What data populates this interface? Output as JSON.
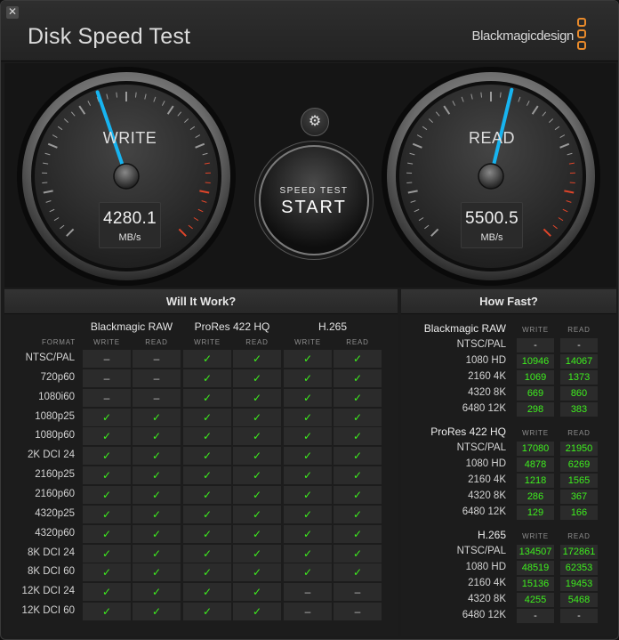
{
  "app": {
    "title": "Disk Speed Test",
    "brand": "Blackmagicdesign",
    "close_glyph": "✕",
    "accent_color": "#e88a2b"
  },
  "gauges": {
    "write": {
      "label": "WRITE",
      "value": "4280.1",
      "unit": "MB/s",
      "fraction": 0.43
    },
    "read": {
      "label": "READ",
      "value": "5500.5",
      "unit": "MB/s",
      "fraction": 0.55
    },
    "needle_color": "#17b4f0",
    "redline_color": "#e0452a"
  },
  "controls": {
    "settings_icon": "gear-icon",
    "settings_glyph": "⚙",
    "start_line1": "SPEED TEST",
    "start_line2": "START"
  },
  "will_it_work": {
    "title": "Will It Work?",
    "format_header": "FORMAT",
    "codecs": [
      "Blackmagic RAW",
      "ProRes 422 HQ",
      "H.265"
    ],
    "col_write": "WRITE",
    "col_read": "READ",
    "ok_glyph": "✓",
    "no_glyph": "–",
    "rows": [
      {
        "format": "NTSC/PAL",
        "cells": [
          0,
          0,
          1,
          1,
          1,
          1
        ]
      },
      {
        "format": "720p60",
        "cells": [
          0,
          0,
          1,
          1,
          1,
          1
        ]
      },
      {
        "format": "1080i60",
        "cells": [
          0,
          0,
          1,
          1,
          1,
          1
        ]
      },
      {
        "format": "1080p25",
        "cells": [
          1,
          1,
          1,
          1,
          1,
          1
        ]
      },
      {
        "format": "1080p60",
        "cells": [
          1,
          1,
          1,
          1,
          1,
          1
        ]
      },
      {
        "format": "2K DCI 24",
        "cells": [
          1,
          1,
          1,
          1,
          1,
          1
        ]
      },
      {
        "format": "2160p25",
        "cells": [
          1,
          1,
          1,
          1,
          1,
          1
        ]
      },
      {
        "format": "2160p60",
        "cells": [
          1,
          1,
          1,
          1,
          1,
          1
        ]
      },
      {
        "format": "4320p25",
        "cells": [
          1,
          1,
          1,
          1,
          1,
          1
        ]
      },
      {
        "format": "4320p60",
        "cells": [
          1,
          1,
          1,
          1,
          1,
          1
        ]
      },
      {
        "format": "8K DCI 24",
        "cells": [
          1,
          1,
          1,
          1,
          1,
          1
        ]
      },
      {
        "format": "8K DCI 60",
        "cells": [
          1,
          1,
          1,
          1,
          1,
          1
        ]
      },
      {
        "format": "12K DCI 24",
        "cells": [
          1,
          1,
          1,
          1,
          0,
          0
        ]
      },
      {
        "format": "12K DCI 60",
        "cells": [
          1,
          1,
          1,
          1,
          0,
          0
        ]
      }
    ]
  },
  "how_fast": {
    "title": "How Fast?",
    "col_write": "WRITE",
    "col_read": "READ",
    "groups": [
      {
        "codec": "Blackmagic RAW",
        "rows": [
          {
            "format": "NTSC/PAL",
            "write": "-",
            "read": "-"
          },
          {
            "format": "1080 HD",
            "write": "10946",
            "read": "14067"
          },
          {
            "format": "2160 4K",
            "write": "1069",
            "read": "1373"
          },
          {
            "format": "4320 8K",
            "write": "669",
            "read": "860"
          },
          {
            "format": "6480 12K",
            "write": "298",
            "read": "383"
          }
        ]
      },
      {
        "codec": "ProRes 422 HQ",
        "rows": [
          {
            "format": "NTSC/PAL",
            "write": "17080",
            "read": "21950"
          },
          {
            "format": "1080 HD",
            "write": "4878",
            "read": "6269"
          },
          {
            "format": "2160 4K",
            "write": "1218",
            "read": "1565"
          },
          {
            "format": "4320 8K",
            "write": "286",
            "read": "367"
          },
          {
            "format": "6480 12K",
            "write": "129",
            "read": "166"
          }
        ]
      },
      {
        "codec": "H.265",
        "rows": [
          {
            "format": "NTSC/PAL",
            "write": "134507",
            "read": "172861"
          },
          {
            "format": "1080 HD",
            "write": "48519",
            "read": "62353"
          },
          {
            "format": "2160 4K",
            "write": "15136",
            "read": "19453"
          },
          {
            "format": "4320 8K",
            "write": "4255",
            "read": "5468"
          },
          {
            "format": "6480 12K",
            "write": "-",
            "read": "-"
          }
        ]
      }
    ]
  }
}
